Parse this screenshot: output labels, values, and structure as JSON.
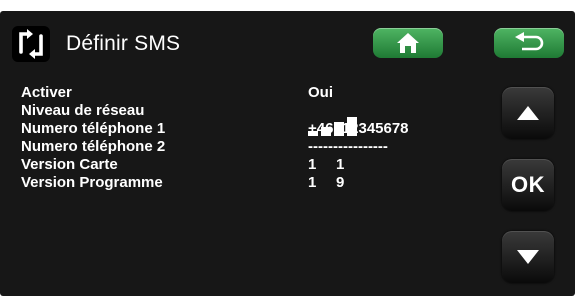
{
  "header": {
    "title": "Définir SMS",
    "menu_icon": "refresh-frame-icon",
    "home_icon": "home-icon",
    "back_icon": "return-arrow-icon"
  },
  "settings": [
    {
      "label": "Activer",
      "value": "Oui"
    },
    {
      "label": "Niveau de réseau",
      "value": "",
      "signal_bars": 4
    },
    {
      "label": "Numero téléphone 1",
      "value": "+46712345678"
    },
    {
      "label": "Numero téléphone 2",
      "value": "----------------"
    },
    {
      "label": "Version Carte",
      "value_major": "1",
      "value_minor": "1"
    },
    {
      "label": "Version Programme",
      "value_major": "1",
      "value_minor": "9"
    }
  ],
  "nav": {
    "up_icon": "arrow-up-icon",
    "ok_label": "OK",
    "down_icon": "arrow-down-icon"
  },
  "colors": {
    "background": "#171717",
    "accent_green": "#2e9a45",
    "text": "#ffffff"
  }
}
